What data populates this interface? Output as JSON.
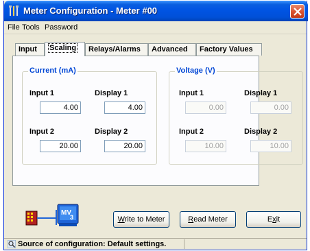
{
  "window": {
    "title": "Meter Configuration - Meter #00"
  },
  "menu": [
    "File",
    "Tools",
    "Password"
  ],
  "tabs": [
    "Input",
    "Scaling",
    "Relays/Alarms",
    "Advanced",
    "Factory Values"
  ],
  "active_tab": "Scaling",
  "current_group": {
    "title": "Current (mA)",
    "input1_label": "Input 1",
    "input1_value": "4.00",
    "display1_label": "Display 1",
    "display1_value": "4.00",
    "input2_label": "Input 2",
    "input2_value": "20.00",
    "display2_label": "Display 2",
    "display2_value": "20.00"
  },
  "voltage_group": {
    "title": "Voltage (V)",
    "input1_label": "Input 1",
    "input1_value": "0.00",
    "display1_label": "Display 1",
    "display1_value": "0.00",
    "input2_label": "Input 2",
    "input2_value": "10.00",
    "display2_label": "Display 2",
    "display2_value": "10.00"
  },
  "buttons": {
    "write_accel": "W",
    "write_rest": "rite to Meter",
    "read_accel": "R",
    "read_rest": "ead Meter",
    "exit_pre": "E",
    "exit_accel": "x",
    "exit_rest": "it"
  },
  "meter_icon_label": "MV",
  "meter_icon_sub": "3",
  "status": {
    "text": "Source of configuration: Default settings."
  },
  "colors": {
    "titlebar": "#0054e3",
    "group_title": "#0046d5",
    "close_button": "#d8512f",
    "window_bg": "#ece9d8"
  }
}
